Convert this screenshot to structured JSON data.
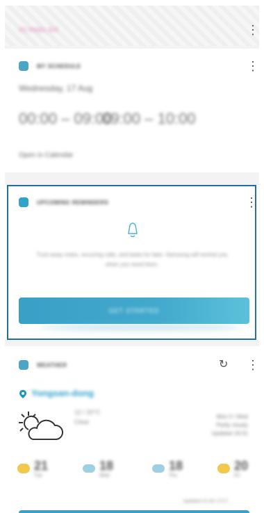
{
  "header": {
    "title": "YC PIXEL KIT",
    "accent": "#e58dc4"
  },
  "schedule": {
    "title": "MY SCHEDULE",
    "date": "Wednesday, 17 Aug",
    "times": [
      "00:00 – 09:00",
      "09:00 – 10:00"
    ],
    "footer": "Open in Calendar"
  },
  "reminders": {
    "title": "UPCOMING REMINDERS",
    "body": "Tuck away notes, recurring calls, and tasks for later. Samsung will remind you when you need them.",
    "button": "GET STARTED",
    "accent": "#2fa3c9"
  },
  "weather": {
    "title": "WEATHER",
    "location": "Yongsan-dong",
    "high_low": [
      "12 / 20°C",
      "Clear"
    ],
    "details": [
      "Mon 5 / Wed",
      "Partly cloudy",
      "Updated 16:01"
    ],
    "forecast": [
      {
        "value": "21",
        "label": "Tue"
      },
      {
        "value": "18",
        "label": "Wed"
      },
      {
        "value": "18",
        "label": "Thu"
      },
      {
        "value": "20",
        "label": "Fri"
      }
    ],
    "updated": "Updated 21:00 17/17"
  },
  "icons": {
    "menu": "more-vertical-icon",
    "refresh": "refresh-icon",
    "location": "location-pin-icon",
    "bell": "bell-icon",
    "sun_cloud": "partly-cloudy-icon"
  }
}
